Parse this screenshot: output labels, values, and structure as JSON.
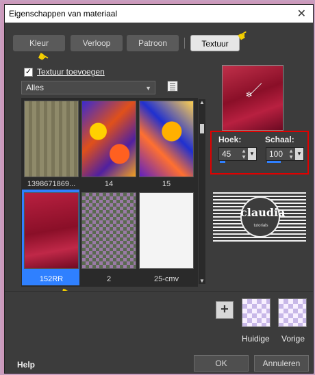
{
  "window": {
    "title": "Eigenschappen van materiaal",
    "close_glyph": "✕"
  },
  "tabs": [
    {
      "label": "Kleur"
    },
    {
      "label": "Verloop"
    },
    {
      "label": "Patroon"
    },
    {
      "label": "Textuur",
      "active": true
    }
  ],
  "texture_add": {
    "checked": true,
    "label": "Textuur toevoegen"
  },
  "category_select": {
    "value": "Alles"
  },
  "thumbnails": [
    {
      "label": "1398671869...",
      "selected": false
    },
    {
      "label": "14",
      "selected": false
    },
    {
      "label": "15",
      "selected": false
    },
    {
      "label": "152RR",
      "selected": true
    },
    {
      "label": "2",
      "selected": false
    },
    {
      "label": "25-cmv",
      "selected": false
    }
  ],
  "params": {
    "angle": {
      "label": "Hoek:",
      "value": "45"
    },
    "scale": {
      "label": "Schaal:",
      "value": "100"
    }
  },
  "logo": {
    "text": "claudia",
    "subtext": "tutorials"
  },
  "swatches": {
    "current_label": "Huidige",
    "previous_label": "Vorige"
  },
  "footer": {
    "help": "Help",
    "ok": "OK",
    "cancel": "Annuleren"
  },
  "colors": {
    "accent": "#2f80ff",
    "highlight_box": "#e00000",
    "hand": "#f5d000"
  },
  "icons": {
    "hand": "pointing-hand-icon",
    "add": "plus-icon",
    "browse": "list-icon"
  }
}
